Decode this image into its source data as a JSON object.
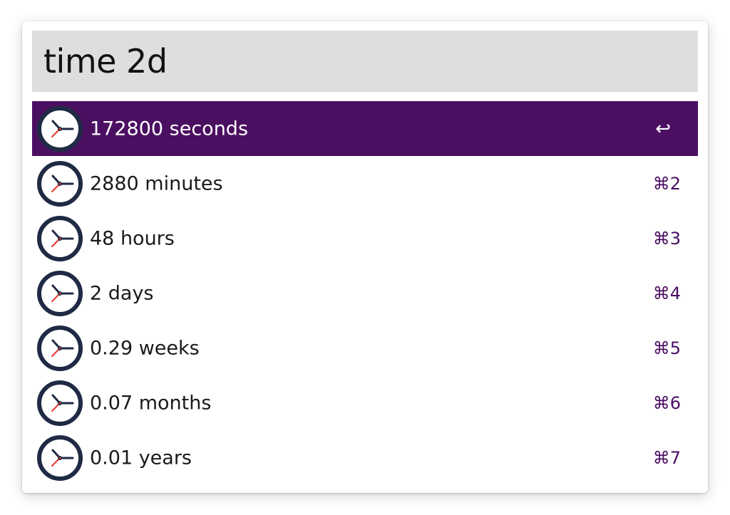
{
  "search": {
    "value": "time 2d"
  },
  "results": [
    {
      "label": "172800 seconds",
      "shortcut": "↩",
      "selected": true
    },
    {
      "label": "2880 minutes",
      "shortcut": "⌘2",
      "selected": false
    },
    {
      "label": "48 hours",
      "shortcut": "⌘3",
      "selected": false
    },
    {
      "label": "2 days",
      "shortcut": "⌘4",
      "selected": false
    },
    {
      "label": "0.29 weeks",
      "shortcut": "⌘5",
      "selected": false
    },
    {
      "label": "0.07 months",
      "shortcut": "⌘6",
      "selected": false
    },
    {
      "label": "0.01 years",
      "shortcut": "⌘7",
      "selected": false
    }
  ],
  "icon": "clock-icon",
  "colors": {
    "accent": "#4b0f62",
    "search_bg": "#dedede",
    "clock_rim": "#1f2a44",
    "clock_hand": "#e53935"
  }
}
